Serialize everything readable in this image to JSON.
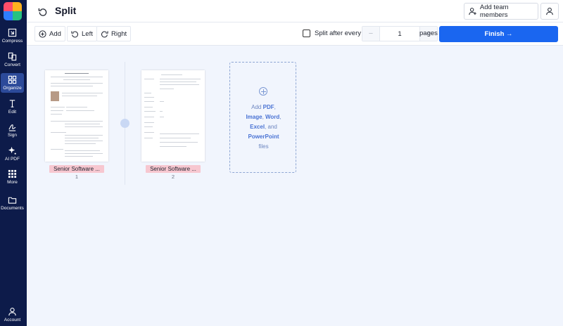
{
  "sidebar": {
    "items": [
      {
        "label": "Compress",
        "icon": "compress-icon"
      },
      {
        "label": "Convert",
        "icon": "convert-icon"
      },
      {
        "label": "Organize",
        "icon": "organize-icon"
      },
      {
        "label": "Edit",
        "icon": "edit-icon"
      },
      {
        "label": "Sign",
        "icon": "sign-icon"
      },
      {
        "label": "AI PDF",
        "icon": "ai-sparkle-icon"
      },
      {
        "label": "More",
        "icon": "grid-icon"
      },
      {
        "label": "Documents",
        "icon": "folder-icon"
      },
      {
        "label": "Account",
        "icon": "account-icon"
      }
    ],
    "active": "Organize"
  },
  "header": {
    "title": "Split",
    "team_label": "Add team members"
  },
  "toolbar": {
    "add_label": "Add",
    "left_label": "Left",
    "right_label": "Right",
    "split_label": "Split after every",
    "split_value": "1",
    "minus_label": "−",
    "plus_label": "+",
    "pages_label": "pages",
    "finish_label": "Finish →"
  },
  "pages": [
    {
      "name": "Senior Software ...",
      "number": "1"
    },
    {
      "name": "Senior Software ...",
      "number": "2"
    }
  ],
  "add_box": {
    "line1_prefix": "Add ",
    "line1_bold": "PDF",
    "line1_suffix": ",",
    "line2_a": "Image",
    "line2_sep": ", ",
    "line2_b": "Word",
    "line2_suffix": ",",
    "line3_a": "Excel",
    "line3_mid": ", and",
    "line4_a": "PowerPoint",
    "line5": "files"
  },
  "colors": {
    "sidebar_bg": "#0d1b4a",
    "accent": "#1a66f0",
    "page_label_bg": "#f7c7d0",
    "canvas_bg": "#f1f5fd"
  }
}
